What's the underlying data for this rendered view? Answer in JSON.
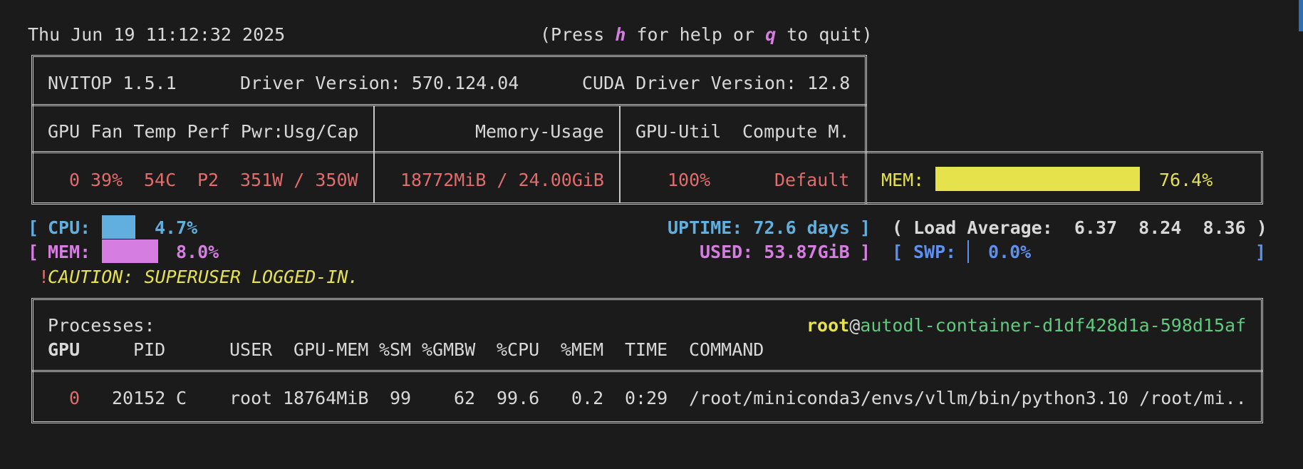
{
  "header": {
    "datetime": "Thu Jun 19 11:12:32 2025",
    "help_pre": "(Press ",
    "help_key": "h",
    "help_mid": " for help or ",
    "quit_key": "q",
    "help_post": " to quit)"
  },
  "info": {
    "nvitop": "NVITOP 1.5.1",
    "driver": "Driver Version: 570.124.04",
    "cuda": "CUDA Driver Version: 12.8"
  },
  "gpu_table": {
    "headers": {
      "left": "GPU Fan Temp Perf Pwr:Usg/Cap",
      "mem": "Memory-Usage",
      "util": "GPU-Util",
      "compute": "Compute M."
    },
    "row": {
      "gpu": "0",
      "fan": "39%",
      "temp": "54C",
      "perf": "P2",
      "power": "351W / 350W",
      "memory": "18772MiB / 24.00GiB",
      "util": "100%",
      "compute": "Default"
    },
    "mem_label": "MEM:",
    "mem_percent": "76.4%",
    "mem_fraction": 0.764
  },
  "host": {
    "open_bracket": "[",
    "close_bracket": "]",
    "cpu_label": "CPU:",
    "cpu_percent": "4.7%",
    "mem_label": "MEM:",
    "mem_percent": "8.0%",
    "uptime": "UPTIME: 72.6 days",
    "used": "USED: 53.87GiB",
    "load": "( Load Average:  6.37  8.24  8.36 )",
    "swp_label": "SWP:",
    "swp_percent": "0.0%",
    "caution_mark": "!",
    "caution": "CAUTION: SUPERUSER LOGGED-IN."
  },
  "processes": {
    "title": "Processes:",
    "user": "root",
    "at": "@",
    "host": "autodl-container-d1df428d1a-598d15af",
    "columns": [
      "GPU",
      "PID",
      "USER",
      "GPU-MEM",
      "%SM",
      "%GMBW",
      "%CPU",
      "%MEM",
      "TIME",
      "COMMAND"
    ],
    "rows": [
      {
        "gpu": "0",
        "pid": "20152",
        "type": "C",
        "user": "root",
        "gpu_mem": "18764MiB",
        "sm": "99",
        "gmbw": "62",
        "cpu": "99.6",
        "mem": "0.2",
        "time": "0:29",
        "command": "/root/miniconda3/envs/vllm/bin/python3.10 /root/mi.."
      }
    ]
  },
  "colors": {
    "background": "#1b1b1b",
    "red": "#e06c6c",
    "blue": "#61afdf",
    "magenta": "#d57de0",
    "yellow": "#e6e24c",
    "green": "#5fc97e"
  }
}
